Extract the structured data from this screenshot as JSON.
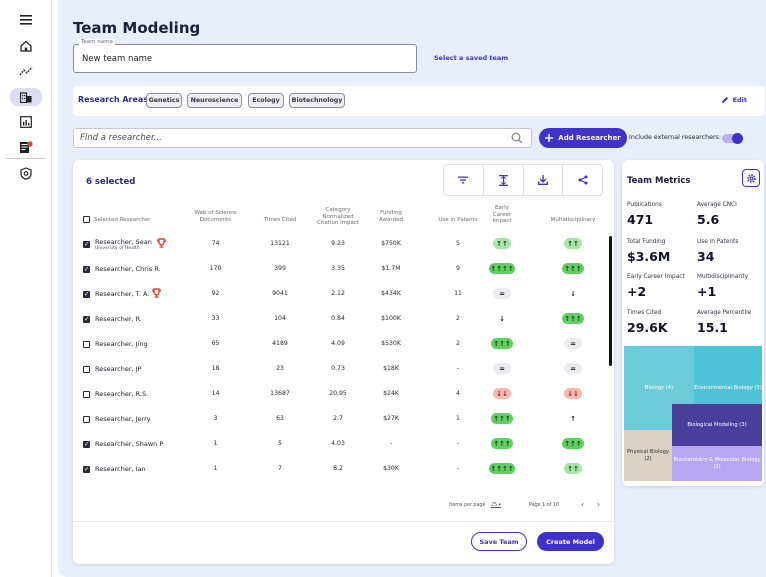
{
  "page": {
    "title": "Team Modeling"
  },
  "team_name": {
    "legend": "Team name",
    "value": "New team name",
    "saved_link": "Select a saved team"
  },
  "research_areas": {
    "label": "Research Areas:",
    "chips": [
      "Genetics",
      "Neuroscience",
      "Ecology",
      "Biotechnology"
    ],
    "edit_label": "Edit"
  },
  "search": {
    "placeholder": "Find a researcher...",
    "add_label": "Add Researcher",
    "external_label": "Include external researchers:",
    "external_on": true
  },
  "table": {
    "selected_text": "6 selected",
    "headers": {
      "name": "Selected Researcher",
      "wos": "Web of Science Documents",
      "cited": "Times Cited",
      "cnci": "Category Normalized Citation Impact",
      "funding": "Funding Awarded",
      "patents": "Use in Patents",
      "early": "Early Career Impact",
      "multi": "Multidisciplinary"
    },
    "rows": [
      {
        "checked": true,
        "name": "Researcher, Sean",
        "sub": "University of Health",
        "trophy": true,
        "wos": "74",
        "cited": "13121",
        "cnci": "9.23",
        "funding": "$750K",
        "patents": "5",
        "early": "↑↑",
        "early_style": "green",
        "multi": "↑↑",
        "multi_style": "green"
      },
      {
        "checked": true,
        "name": "Researcher, Chris R.",
        "sub": "",
        "trophy": false,
        "wos": "170",
        "cited": "399",
        "cnci": "3.35",
        "funding": "$1.7M",
        "patents": "9",
        "early": "↑↑↑↑",
        "early_style": "greenD",
        "multi": "↑↑↑",
        "multi_style": "greenD"
      },
      {
        "checked": true,
        "name": "Researcher, T. A.",
        "sub": "",
        "trophy": true,
        "wos": "92",
        "cited": "9041",
        "cnci": "2.12",
        "funding": "$434K",
        "patents": "11",
        "early": "=",
        "early_style": "grey",
        "multi": "↓",
        "multi_style": "white"
      },
      {
        "checked": true,
        "name": "Researcher, R.",
        "sub": "",
        "trophy": false,
        "wos": "33",
        "cited": "104",
        "cnci": "0.84",
        "funding": "$100K",
        "patents": "2",
        "early": "↓",
        "early_style": "white",
        "multi": "↑↑↑",
        "multi_style": "greenD"
      },
      {
        "checked": false,
        "name": "Researcher, Jing",
        "sub": "",
        "trophy": false,
        "wos": "65",
        "cited": "4189",
        "cnci": "4.09",
        "funding": "$530K",
        "patents": "2",
        "early": "↑↑↑",
        "early_style": "greenD",
        "multi": "=",
        "multi_style": "grey"
      },
      {
        "checked": false,
        "name": "Researcher, JP",
        "sub": "",
        "trophy": false,
        "wos": "18",
        "cited": "23",
        "cnci": "0.73",
        "funding": "$18K",
        "patents": "-",
        "early": "=",
        "early_style": "grey",
        "multi": "=",
        "multi_style": "grey"
      },
      {
        "checked": false,
        "name": "Researcher, R.S.",
        "sub": "",
        "trophy": false,
        "wos": "14",
        "cited": "13687",
        "cnci": "20.95",
        "funding": "$24K",
        "patents": "4",
        "early": "↓↓",
        "early_style": "red",
        "multi": "↓↓",
        "multi_style": "red"
      },
      {
        "checked": false,
        "name": "Researcher, Jerry",
        "sub": "",
        "trophy": false,
        "wos": "3",
        "cited": "63",
        "cnci": "2.7",
        "funding": "$27K",
        "patents": "1",
        "early": "↑↑↑",
        "early_style": "greenD",
        "multi": "↑",
        "multi_style": "white"
      },
      {
        "checked": true,
        "name": "Researcher, Shawn P",
        "sub": "",
        "trophy": false,
        "wos": "1",
        "cited": "5",
        "cnci": "4.03",
        "funding": "-",
        "patents": "-",
        "early": "↑↑↑",
        "early_style": "greenD",
        "multi": "↑↑↑",
        "multi_style": "greenD"
      },
      {
        "checked": true,
        "name": "Researcher, Ian",
        "sub": "",
        "trophy": false,
        "wos": "1",
        "cited": "7",
        "cnci": "8.2",
        "funding": "$30K",
        "patents": "-",
        "early": "↑↑↑↑",
        "early_style": "greenD",
        "multi": "↑↑",
        "multi_style": "green"
      }
    ],
    "pager": {
      "items_label": "Items per page",
      "per_page": "25",
      "page_text": "Page 1 of 10"
    },
    "save_label": "Save Team",
    "create_label": "Create Model"
  },
  "metrics": {
    "title": "Team Metrics",
    "items": [
      {
        "label": "Publications",
        "value": "471"
      },
      {
        "label": "Average CNCI",
        "value": "5.6"
      },
      {
        "label": "Total Funding",
        "value": "$3.6M"
      },
      {
        "label": "Use in Patents",
        "value": "34"
      },
      {
        "label": "Early Career Impact",
        "value": "+2"
      },
      {
        "label": "Multidisciplinarity",
        "value": "+1"
      },
      {
        "label": "Times Cited",
        "value": "29.6K"
      },
      {
        "label": "Average Percentile",
        "value": "15.1"
      }
    ],
    "treemap": [
      {
        "label": "Biology (4)",
        "color": "#6ccbd8"
      },
      {
        "label": "Environmental Biology (3)",
        "color": "#4ec2d6"
      },
      {
        "label": "Physical Biology (2)",
        "color": "#d9d2c3"
      },
      {
        "label": "Biological Modeling (3)",
        "color": "#4b3f9e"
      },
      {
        "label": "Biochemistry & Molecular Biology (2)",
        "color": "#b7a6f2"
      }
    ]
  },
  "colors": {
    "accent": "#3f32c9",
    "trophy": "#d8452f",
    "notification": "#e0442f"
  },
  "icons": [
    "menu-icon",
    "home-icon",
    "trend-icon",
    "building-icon",
    "chart-icon",
    "document-icon",
    "badge-icon",
    "search-icon",
    "plus-icon",
    "filter-icon",
    "align-icon",
    "download-icon",
    "share-icon",
    "gear-icon",
    "pencil-icon",
    "trophy-icon"
  ]
}
